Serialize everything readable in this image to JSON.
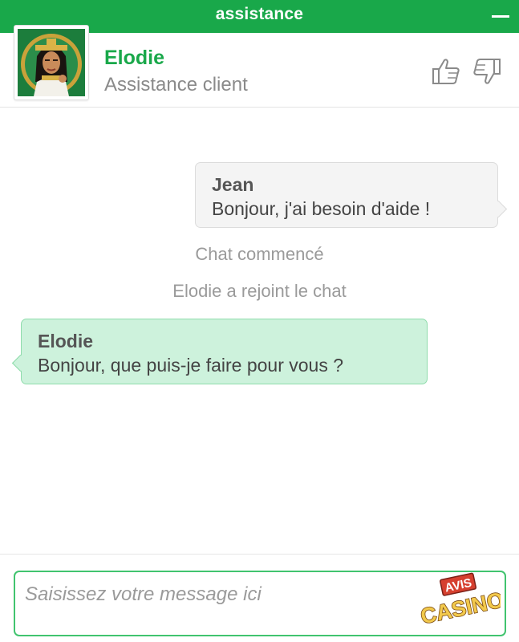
{
  "window": {
    "title": "assistance",
    "minimize_icon": "minus-icon"
  },
  "agent": {
    "name": "Elodie",
    "role": "Assistance client",
    "avatar": "pharaoh-queen-avatar",
    "rate_up_icon": "thumbs-up-icon",
    "rate_down_icon": "thumbs-down-icon"
  },
  "messages": [
    {
      "sender": "Jean",
      "text": "Bonjour, j'ai besoin d'aide !",
      "side": "right"
    },
    {
      "sender": "Elodie",
      "text": "Bonjour, que puis-je faire pour vous ?",
      "side": "left"
    }
  ],
  "system_messages": [
    "Chat commencé",
    "Elodie a rejoint le chat"
  ],
  "composer": {
    "placeholder": "Saisissez votre message ici"
  },
  "watermark": {
    "line1": "AVIS",
    "line2": "CASINO"
  },
  "colors": {
    "brand_green": "#19a84a",
    "agent_bubble": "#cdf2dc",
    "user_bubble": "#f4f4f4",
    "input_border": "#41c46f"
  }
}
